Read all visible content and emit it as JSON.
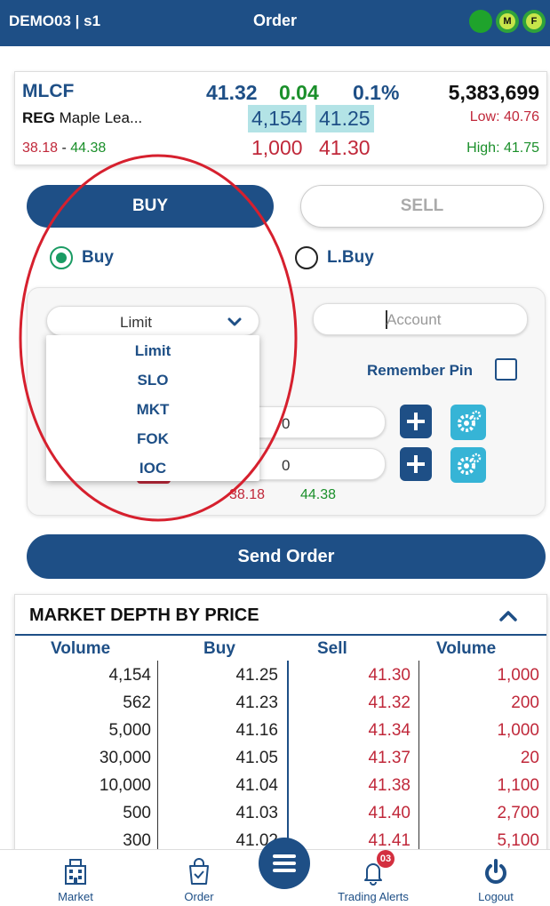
{
  "header": {
    "account": "DEMO03 | s1",
    "title": "Order",
    "badge_m": "M",
    "badge_f": "F"
  },
  "quote": {
    "symbol": "MLCF",
    "last": "41.32",
    "change": "0.04",
    "change_pct": "0.1%",
    "volume": "5,383,699",
    "board": "REG",
    "name": "Maple Lea...",
    "bid_size": "4,154",
    "bid_price": "41.25",
    "low": "Low: 40.76",
    "range_low": "38.18",
    "range_sep": " - ",
    "range_high": "44.38",
    "ask_size": "1,000",
    "ask_price": "41.30",
    "high": "High: 41.75"
  },
  "side": {
    "buy_label": "BUY",
    "sell_label": "SELL"
  },
  "order_kind": {
    "buy": "Buy",
    "lbuy": "L.Buy",
    "selected": "Buy"
  },
  "form": {
    "order_type": "Limit",
    "account_placeholder": "Account",
    "remember_pin": "Remember Pin",
    "quantity": "0",
    "price": "0",
    "limit_low": "38.18",
    "limit_high": "44.38"
  },
  "order_type_options": [
    "Limit",
    "SLO",
    "MKT",
    "FOK",
    "IOC"
  ],
  "send_order_label": "Send Order",
  "market_depth": {
    "title": "MARKET DEPTH BY PRICE",
    "headers": [
      "Volume",
      "Buy",
      "Sell",
      "Volume"
    ],
    "rows": [
      [
        "4,154",
        "41.25",
        "41.30",
        "1,000"
      ],
      [
        "562",
        "41.23",
        "41.32",
        "200"
      ],
      [
        "5,000",
        "41.16",
        "41.34",
        "1,000"
      ],
      [
        "30,000",
        "41.05",
        "41.37",
        "20"
      ],
      [
        "10,000",
        "41.04",
        "41.38",
        "1,100"
      ],
      [
        "500",
        "41.03",
        "41.40",
        "2,700"
      ],
      [
        "300",
        "41.02",
        "41.41",
        "5,100"
      ]
    ]
  },
  "nav": {
    "market": "Market",
    "order": "Order",
    "alerts": "Trading Alerts",
    "alerts_count": "03",
    "logout": "Logout"
  },
  "colors": {
    "primary": "#1e4f86",
    "up": "#1a8f2a",
    "down": "#c0283a",
    "highlight": "#b3e3e6",
    "annotation": "#d6202e"
  }
}
